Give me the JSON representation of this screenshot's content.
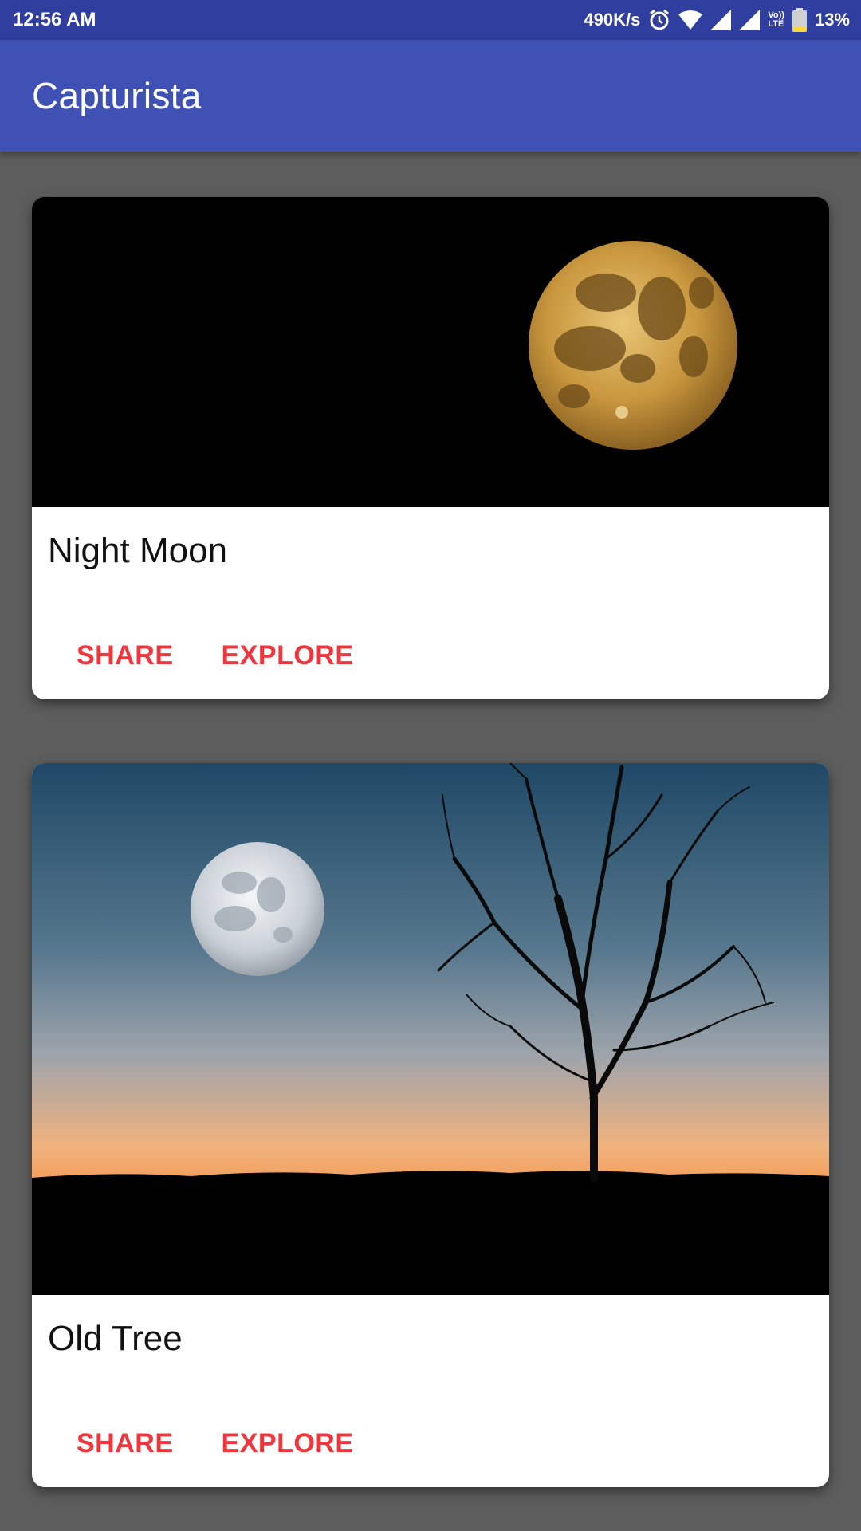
{
  "status_bar": {
    "time": "12:56 AM",
    "network_speed": "490K/s",
    "battery_percent": "13%",
    "lte_label_top": "Vo))",
    "lte_label_bottom": "LTE",
    "icons": [
      "alarm-icon",
      "wifi-icon",
      "signal-icon",
      "signal-icon",
      "volte-icon",
      "battery-icon"
    ]
  },
  "app_bar": {
    "title": "Capturista"
  },
  "cards": [
    {
      "title": "Night Moon",
      "image": "golden-full-moon-on-black-sky",
      "share_label": "SHARE",
      "explore_label": "EXPLORE"
    },
    {
      "title": "Old Tree",
      "image": "bare-tree-silhouette-with-moon-at-sunset",
      "share_label": "SHARE",
      "explore_label": "EXPLORE"
    }
  ],
  "colors": {
    "status_bar": "#303f9f",
    "app_bar": "#3f51b5",
    "background": "#5d5d5d",
    "accent": "#f0363c"
  }
}
